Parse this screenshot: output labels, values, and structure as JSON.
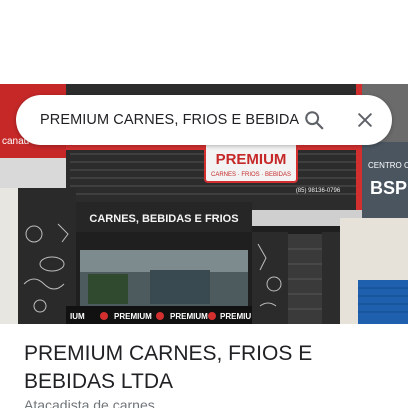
{
  "search": {
    "query": "PREMIUM CARNES, FRIOS E BEBIDA",
    "search_icon": "search-icon",
    "close_icon": "close-icon"
  },
  "photo": {
    "left_sign_fragment": "canau",
    "main_sign_line1": "PREMIUM",
    "main_sign_line2": "CARNES · FRIOS · BEBIDAS",
    "phone_fragment": "(85) 98136-0796",
    "awning_text": "CARNES, BEBIDAS E FRIOS",
    "right_sign_line1": "CENTRO C",
    "right_sign_line2": "BSP",
    "window_banner": [
      "IUM",
      "PREMIUM",
      "PREMIUM",
      "PREMIU"
    ]
  },
  "place": {
    "title": "PREMIUM CARNES, FRIOS E BEBIDAS LTDA",
    "category": "Atacadista de carnes"
  },
  "colors": {
    "accent_red": "#d32f2f",
    "text_primary": "#202124",
    "text_secondary": "#70757a",
    "icon_gray": "#5f6368"
  }
}
